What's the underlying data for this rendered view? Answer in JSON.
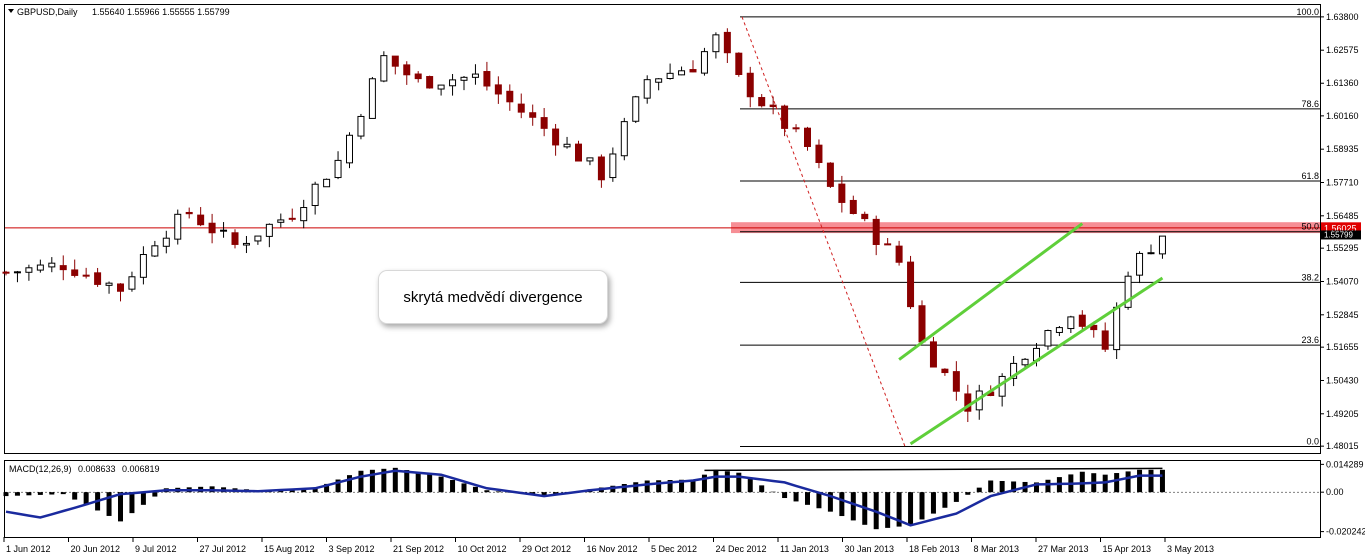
{
  "header": {
    "symbol": "GBPUSD,Daily",
    "ohlc": "1.55640 1.55966 1.55555 1.55799"
  },
  "macd_header": {
    "label": "MACD(12,26,9)",
    "main": "0.008633",
    "signal": "0.006819"
  },
  "annotation": "skrytá medvědí divergence",
  "colors": {
    "bull": "#000000",
    "bear": "#8b0000",
    "macd_line": "#1a2a9e",
    "fib": "#000000",
    "fib_diag": "#d02020",
    "channel": "#5fcf3a",
    "zone": "#f47a82",
    "hline": "#cc0000",
    "price_tag": "#e00000"
  },
  "chart_data": [
    {
      "type": "candlestick",
      "title": "GBPUSD,Daily",
      "ylim": [
        1.478,
        1.642
      ],
      "price_ticks": [
        "1.63800",
        "1.62575",
        "1.61360",
        "1.60160",
        "1.58935",
        "1.57710",
        "1.56485",
        "1.55295",
        "1.54070",
        "1.52845",
        "1.51655",
        "1.50430",
        "1.49205",
        "1.48015"
      ],
      "date_ticks": [
        "1 Jun 2012",
        "20 Jun 2012",
        "9 Jul 2012",
        "27 Jul 2012",
        "15 Aug 2012",
        "3 Sep 2012",
        "21 Sep 2012",
        "10 Oct 2012",
        "29 Oct 2012",
        "16 Nov 2012",
        "5 Dec 2012",
        "24 Dec 2012",
        "11 Jan 2013",
        "30 Jan 2013",
        "18 Feb 2013",
        "8 Mar 2013",
        "27 Mar 2013",
        "15 Apr 2013",
        "3 May 2013"
      ],
      "current_price": "1.56025",
      "current_price_secondary": "1.55799",
      "horizontal_line": 1.5604,
      "resistance_zone": [
        1.5585,
        1.5625
      ],
      "fibonacci": {
        "high": 1.638,
        "low": 1.48,
        "levels": [
          {
            "label": "100.0",
            "ratio": 1.0
          },
          {
            "label": "78.6",
            "ratio": 0.786
          },
          {
            "label": "61.8",
            "ratio": 0.618
          },
          {
            "label": "50.0",
            "ratio": 0.5
          },
          {
            "label": "38.2",
            "ratio": 0.382
          },
          {
            "label": "23.6",
            "ratio": 0.236
          },
          {
            "label": "0.0",
            "ratio": 0.0
          }
        ]
      },
      "channel": {
        "upper": [
          {
            "x": 78,
            "y": 1.512
          },
          {
            "x": 94,
            "y": 1.562
          }
        ],
        "lower": [
          {
            "x": 79,
            "y": 1.481
          },
          {
            "x": 101,
            "y": 1.542
          }
        ]
      },
      "close_anchors": [
        [
          0,
          1.544
        ],
        [
          5,
          1.547
        ],
        [
          10,
          1.538
        ],
        [
          13,
          1.556
        ],
        [
          16,
          1.566
        ],
        [
          20,
          1.554
        ],
        [
          25,
          1.566
        ],
        [
          29,
          1.585
        ],
        [
          33,
          1.623
        ],
        [
          36,
          1.614
        ],
        [
          41,
          1.616
        ],
        [
          47,
          1.597
        ],
        [
          52,
          1.58
        ],
        [
          56,
          1.615
        ],
        [
          60,
          1.62
        ],
        [
          62,
          1.63
        ],
        [
          64,
          1.615
        ],
        [
          70,
          1.59
        ],
        [
          72,
          1.575
        ],
        [
          78,
          1.548
        ],
        [
          80,
          1.518
        ],
        [
          84,
          1.495
        ],
        [
          87,
          1.505
        ],
        [
          89,
          1.515
        ],
        [
          93,
          1.53
        ],
        [
          96,
          1.516
        ],
        [
          98,
          1.545
        ],
        [
          101,
          1.558
        ]
      ],
      "candle_count": 102
    },
    {
      "type": "histogram+line",
      "title": "MACD(12,26,9)",
      "ylim": [
        -0.0225,
        0.0155
      ],
      "ticks": [
        "0.014289",
        "0.00",
        "-0.020242"
      ],
      "macd_anchors": [
        [
          0,
          -0.002
        ],
        [
          5,
          -0.001
        ],
        [
          10,
          -0.015
        ],
        [
          14,
          0.002
        ],
        [
          18,
          0.003
        ],
        [
          22,
          0.001
        ],
        [
          27,
          0.002
        ],
        [
          31,
          0.011
        ],
        [
          34,
          0.0125
        ],
        [
          38,
          0.008
        ],
        [
          42,
          0.001
        ],
        [
          47,
          -0.002
        ],
        [
          51,
          0.0015
        ],
        [
          56,
          0.006
        ],
        [
          60,
          0.0065
        ],
        [
          62,
          0.0115
        ],
        [
          64,
          0.01
        ],
        [
          68,
          -0.003
        ],
        [
          72,
          -0.01
        ],
        [
          76,
          -0.019
        ],
        [
          79,
          -0.017
        ],
        [
          83,
          -0.005
        ],
        [
          86,
          0.006
        ],
        [
          90,
          0.005
        ],
        [
          94,
          0.0105
        ],
        [
          96,
          0.009
        ],
        [
          99,
          0.0115
        ]
      ],
      "signal_anchors": [
        [
          0,
          -0.01
        ],
        [
          3,
          -0.013
        ],
        [
          6,
          -0.008
        ],
        [
          10,
          -0.001
        ],
        [
          14,
          0.001
        ],
        [
          18,
          0.001
        ],
        [
          22,
          0.0005
        ],
        [
          27,
          0.002
        ],
        [
          31,
          0.008
        ],
        [
          34,
          0.011
        ],
        [
          38,
          0.009
        ],
        [
          42,
          0.002
        ],
        [
          47,
          -0.002
        ],
        [
          51,
          0.001
        ],
        [
          56,
          0.004
        ],
        [
          60,
          0.006
        ],
        [
          62,
          0.008
        ],
        [
          64,
          0.008
        ],
        [
          68,
          0.005
        ],
        [
          72,
          -0.002
        ],
        [
          76,
          -0.01
        ],
        [
          79,
          -0.017
        ],
        [
          83,
          -0.011
        ],
        [
          86,
          -0.002
        ],
        [
          90,
          0.004
        ],
        [
          94,
          0.0045
        ],
        [
          96,
          0.005
        ],
        [
          99,
          0.0085
        ]
      ],
      "divergence_line": [
        {
          "x": 61,
          "y": 0.0112
        },
        {
          "x": 101,
          "y": 0.0122
        }
      ]
    }
  ]
}
